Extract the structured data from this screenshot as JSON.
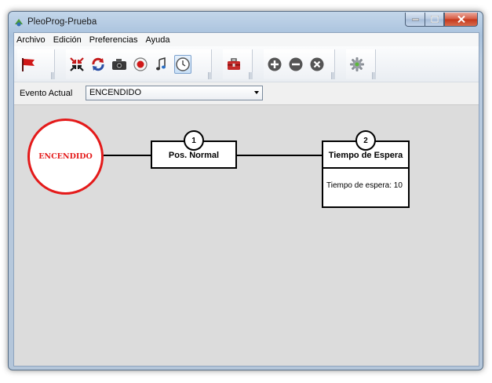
{
  "window": {
    "title": "PleoProg-Prueba"
  },
  "menu": {
    "items": [
      "Archivo",
      "Edición",
      "Preferencias",
      "Ayuda"
    ]
  },
  "toolbar": {
    "groups": [
      [
        "flag-icon"
      ],
      [
        "collapse-arrows-icon",
        "swap-arrows-icon",
        "camera-icon",
        "record-icon",
        "music-note-icon",
        "clock-icon"
      ],
      [
        "toolbox-icon"
      ],
      [
        "add-circle-icon",
        "remove-circle-icon",
        "close-circle-icon"
      ],
      [
        "gear-icon"
      ]
    ],
    "pressed": "clock-icon"
  },
  "event": {
    "label": "Evento Actual",
    "selected": "ENCENDIDO"
  },
  "diagram": {
    "start_state": {
      "label": "ENCENDIDO",
      "color": "#e41a1a"
    },
    "nodes": [
      {
        "number": "1",
        "title": "Pos. Normal"
      },
      {
        "number": "2",
        "title": "Tiempo de Espera",
        "detail": "Tiempo de espera: 10"
      }
    ]
  }
}
